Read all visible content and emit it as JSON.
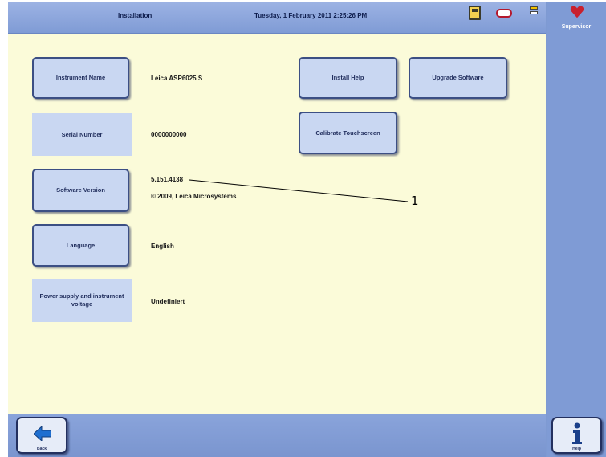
{
  "header": {
    "title": "Installation",
    "datetime": "Tuesday, 1 February 2011 2:25:26 PM",
    "status_icons": [
      "disk-icon",
      "tag-icon",
      "warning-icon"
    ]
  },
  "user": {
    "label": "Supervisor",
    "icon": "heart-icon",
    "icon_color": "#c8202e"
  },
  "fields": {
    "instrument_name": {
      "label": "Instrument Name",
      "value": "Leica ASP6025 S"
    },
    "serial_number": {
      "label": "Serial Number",
      "value": "0000000000"
    },
    "software_version": {
      "label": "Software Version",
      "value": "5.151.4138",
      "copyright": "© 2009, Leica Microsystems"
    },
    "language": {
      "label": "Language",
      "value": "English"
    },
    "power_supply": {
      "label": "Power supply and instrument voltage",
      "value": "Undefiniert"
    }
  },
  "actions": {
    "install_help": "Install Help",
    "upgrade_software": "Upgrade Software",
    "calibrate_touchscreen": "Calibrate Touchscreen"
  },
  "footer": {
    "back_label": "Back",
    "help_label": "Help"
  },
  "annotation": {
    "callout": "1"
  },
  "colors": {
    "background": "#fbfbd9",
    "bar": "#7f9bd5",
    "button": "#c9d7f2",
    "button_border": "#3c4f84"
  }
}
